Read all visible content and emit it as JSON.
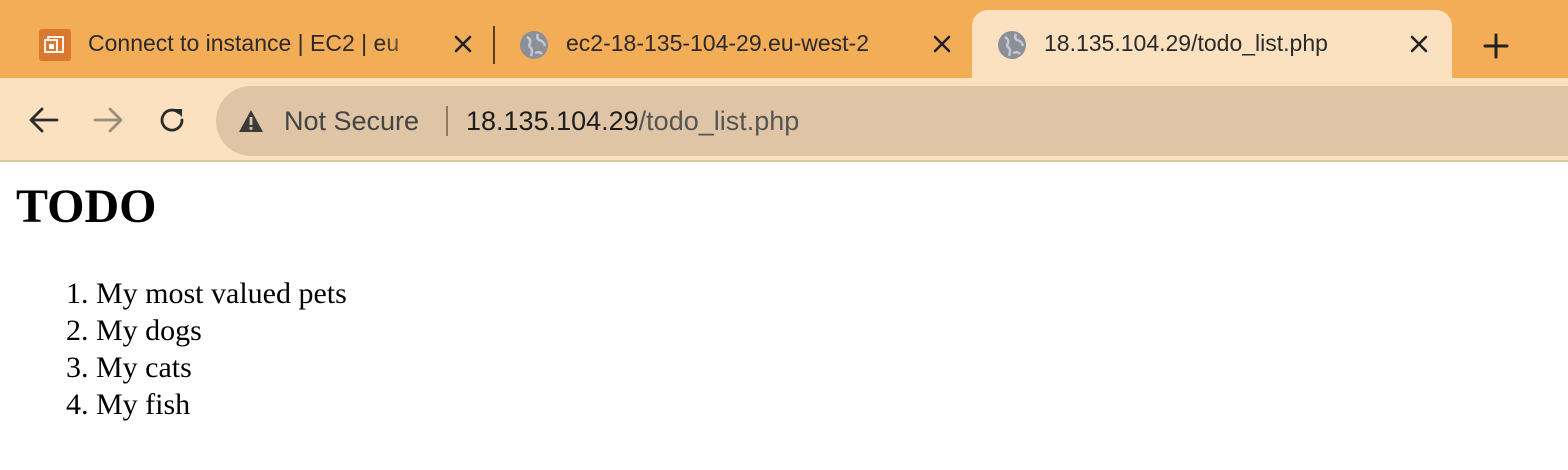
{
  "browser": {
    "tabs": [
      {
        "title": "Connect to instance | EC2 | eu",
        "favicon": "aws-ec2-icon"
      },
      {
        "title": "ec2-18-135-104-29.eu-west-2",
        "favicon": "globe-icon"
      },
      {
        "title": "18.135.104.29/todo_list.php",
        "favicon": "globe-icon",
        "active": true
      }
    ],
    "new_tab_icon": "plus-icon",
    "security_label": "Not Secure",
    "url_host": "18.135.104.29",
    "url_path": "/todo_list.php",
    "colors": {
      "tabstrip": "#f2ad56",
      "toolbar": "#fbe1bf",
      "omnibox": "#dfc5a6"
    }
  },
  "page": {
    "heading": "TODO",
    "items": [
      {
        "text": "My most valued pets"
      },
      {
        "text": "My dogs"
      },
      {
        "text": "My cats"
      },
      {
        "text": "My fish"
      }
    ]
  }
}
